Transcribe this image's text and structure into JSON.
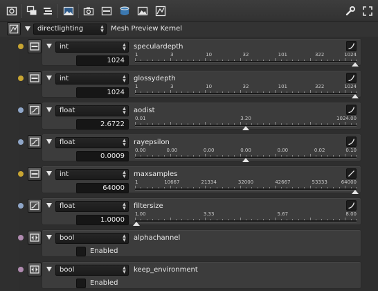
{
  "toolbar": {
    "icons": [
      "render-node-icon",
      "copy-layers-icon",
      "list-icon",
      "image-icon",
      "camera-icon",
      "panel-icon",
      "layers-icon",
      "picture-icon",
      "node-graph-icon",
      "wrench-icon",
      "fullscreen-icon"
    ]
  },
  "header": {
    "kernel_value": "directlighting",
    "title": "Mesh Preview Kernel"
  },
  "params": [
    {
      "name": "speculardepth",
      "type": "int",
      "value": "1024",
      "dot_color": "#c8a532",
      "ticks": [
        "1",
        "3",
        "10",
        "32",
        "101",
        "322",
        "1024"
      ],
      "handle_fraction": 1.0,
      "kind": "slider",
      "icon": "int-icon",
      "curve": "curve-icon"
    },
    {
      "name": "glossydepth",
      "type": "int",
      "value": "1024",
      "dot_color": "#c8a532",
      "ticks": [
        "1",
        "3",
        "10",
        "32",
        "101",
        "322",
        "1024"
      ],
      "handle_fraction": 1.0,
      "kind": "slider",
      "icon": "int-icon",
      "curve": "curve-icon"
    },
    {
      "name": "aodist",
      "type": "float",
      "value": "2.6722",
      "dot_color": "#8fa6c8",
      "ticks": [
        "0.01",
        "3.20",
        "1024.00"
      ],
      "tick_pos": [
        0,
        0.5,
        1
      ],
      "handle_fraction": 0.5,
      "kind": "slider",
      "icon": "float-icon",
      "curve": "curve-icon"
    },
    {
      "name": "rayepsilon",
      "type": "float",
      "value": "0.0009",
      "dot_color": "#8fa6c8",
      "ticks": [
        "0.00",
        "0.00",
        "0.00",
        "0.00",
        "0.00",
        "0.02",
        "0.10"
      ],
      "handle_fraction": 0.5,
      "kind": "slider",
      "icon": "float-icon",
      "curve": "curve-icon"
    },
    {
      "name": "maxsamples",
      "type": "int",
      "value": "64000",
      "dot_color": "#c8a532",
      "ticks": [
        "1",
        "10667",
        "21334",
        "32000",
        "42667",
        "53333",
        "64000"
      ],
      "handle_fraction": 1.0,
      "kind": "slider",
      "icon": "int-icon",
      "curve": "linear-icon"
    },
    {
      "name": "filtersize",
      "type": "float",
      "value": "1.0000",
      "dot_color": "#8fa6c8",
      "ticks": [
        "1.00",
        "3.33",
        "5.67",
        "8.00"
      ],
      "handle_fraction": 0.0,
      "kind": "slider",
      "icon": "float-icon",
      "curve": "curve-icon"
    },
    {
      "name": "alphachannel",
      "type": "bool",
      "value": "Enabled",
      "dot_color": "#b08bb0",
      "kind": "bool",
      "icon": "bool-icon"
    },
    {
      "name": "keep_environment",
      "type": "bool",
      "value": "Enabled",
      "dot_color": "#b08bb0",
      "kind": "bool",
      "icon": "bool-icon"
    }
  ]
}
